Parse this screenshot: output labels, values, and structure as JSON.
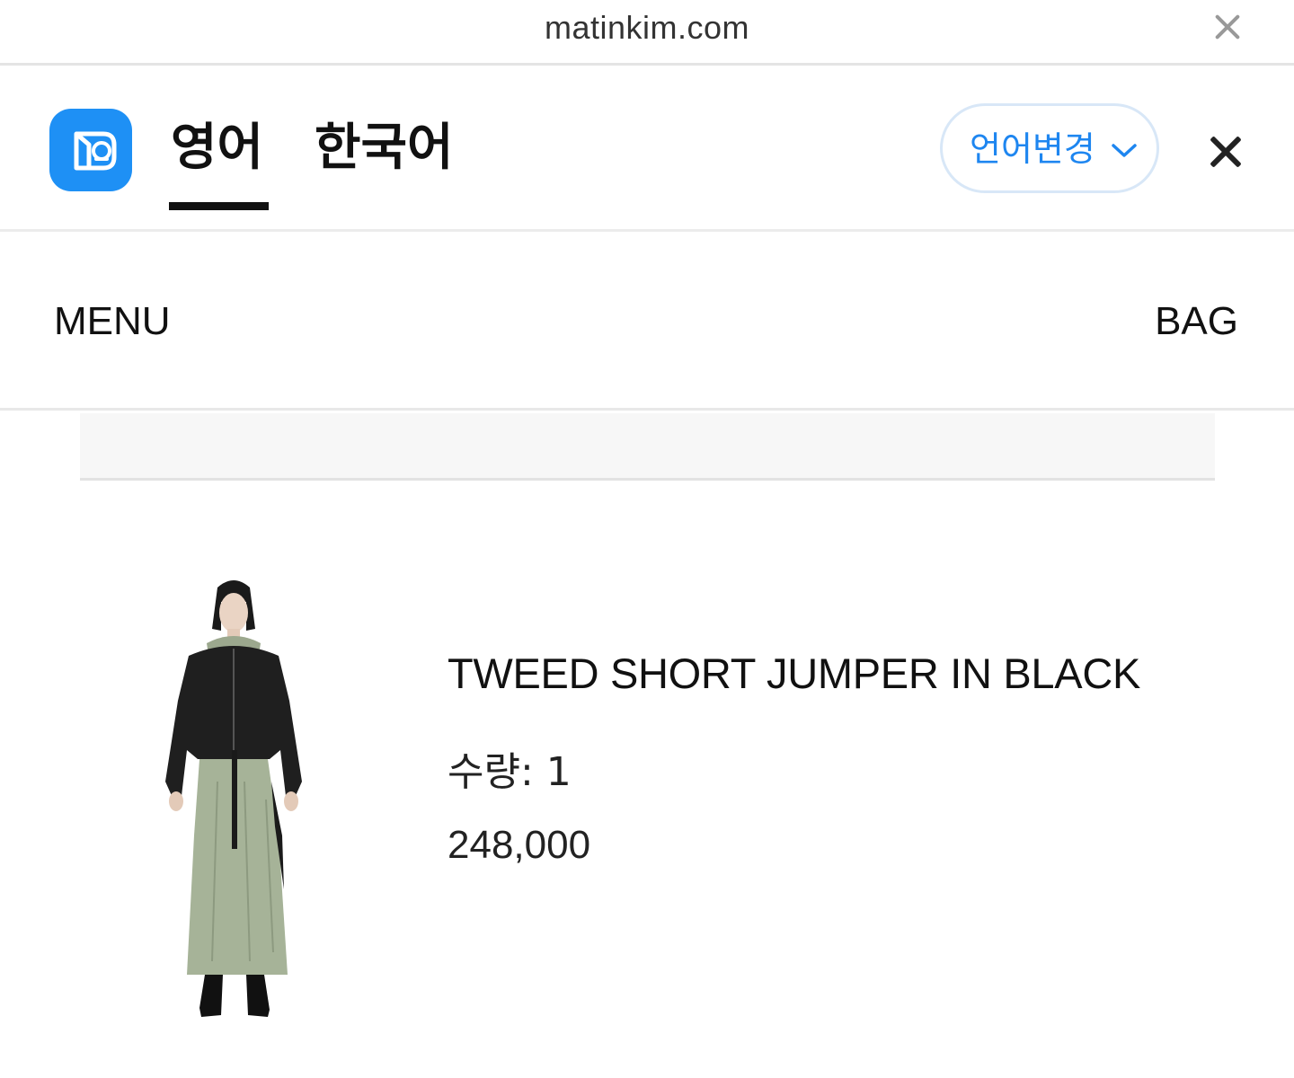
{
  "browser": {
    "url": "matinkim.com"
  },
  "translate_bar": {
    "languages": [
      {
        "label": "영어",
        "active": true
      },
      {
        "label": "한국어",
        "active": false
      }
    ],
    "change_language_label": "언어변경",
    "accent_color": "#1e90f5"
  },
  "header": {
    "menu_label": "MENU",
    "bag_label": "BAG"
  },
  "product": {
    "title": "TWEED SHORT JUMPER IN BLACK",
    "quantity_label": "수량: 1",
    "price": "248,000",
    "image_description": "model-wearing-black-cropped-jumper-over-sage-green-dress"
  }
}
